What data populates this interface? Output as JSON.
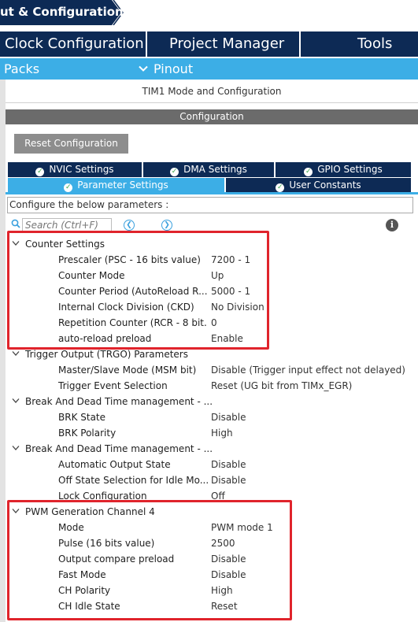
{
  "breadcrumb": {
    "label": "ut & Configuration"
  },
  "main_tabs": [
    "Clock Configuration",
    "Project Manager",
    "Tools"
  ],
  "sub_bar": {
    "packs": "Packs",
    "pinout": "Pinout"
  },
  "mode_title": "TIM1 Mode and Configuration",
  "configuration_label": "Configuration",
  "reset_button": "Reset Configuration",
  "settings_tabs": {
    "nvic": "NVIC Settings",
    "dma": "DMA Settings",
    "gpio": "GPIO Settings",
    "parameter": "Parameter Settings",
    "user_constants": "User Constants"
  },
  "configure_text": "Configure the below parameters :",
  "search": {
    "placeholder": "Search (Ctrl+F)"
  },
  "groups": [
    {
      "label": "Counter Settings",
      "params": [
        {
          "name": "Prescaler (PSC - 16 bits value)",
          "value": "7200 - 1"
        },
        {
          "name": "Counter Mode",
          "value": "Up"
        },
        {
          "name": "Counter Period (AutoReload R...",
          "value": "5000 - 1"
        },
        {
          "name": "Internal Clock Division (CKD)",
          "value": "No Division"
        },
        {
          "name": "Repetition Counter (RCR - 8 bit...",
          "value": "0"
        },
        {
          "name": "auto-reload preload",
          "value": "Enable"
        }
      ]
    },
    {
      "label": "Trigger Output (TRGO) Parameters",
      "params": [
        {
          "name": "Master/Slave Mode (MSM bit)",
          "value": "Disable (Trigger input effect not delayed)"
        },
        {
          "name": "Trigger Event Selection",
          "value": "Reset (UG bit from TIMx_EGR)"
        }
      ]
    },
    {
      "label": "Break And Dead Time management - ...",
      "params": [
        {
          "name": "BRK State",
          "value": "Disable"
        },
        {
          "name": "BRK Polarity",
          "value": "High"
        }
      ]
    },
    {
      "label": "Break And Dead Time management - ...",
      "params": [
        {
          "name": "Automatic Output State",
          "value": "Disable"
        },
        {
          "name": "Off State Selection for Idle Mo...",
          "value": "Disable"
        },
        {
          "name": "Lock Configuration",
          "value": "Off"
        }
      ]
    },
    {
      "label": "PWM Generation Channel 4",
      "params": [
        {
          "name": "Mode",
          "value": "PWM mode 1"
        },
        {
          "name": "Pulse (16 bits value)",
          "value": "2500"
        },
        {
          "name": "Output compare preload",
          "value": "Disable"
        },
        {
          "name": "Fast Mode",
          "value": "Disable"
        },
        {
          "name": "CH Polarity",
          "value": "High"
        },
        {
          "name": "CH Idle State",
          "value": "Reset"
        }
      ]
    }
  ],
  "colors": {
    "navy": "#0d2a55",
    "accent_blue": "#3caee6",
    "highlight_red": "#e0242c",
    "check_green": "#3aa64a"
  }
}
